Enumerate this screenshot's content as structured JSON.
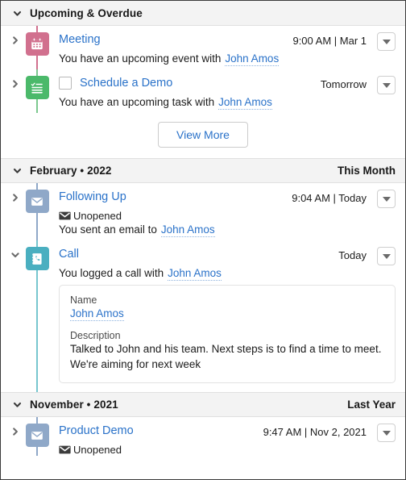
{
  "colors": {
    "link": "#2a72c9",
    "header_bg": "#f3f3f3",
    "event_badge": "#d1708e",
    "task_badge": "#4bb96a",
    "email_badge": "#8fa8c8",
    "call_badge": "#4aafc0"
  },
  "sections": [
    {
      "id": "upcoming",
      "title": "Upcoming & Overdue",
      "meta": "",
      "expanded": true
    },
    {
      "id": "february",
      "title": "February • 2022",
      "meta": "This Month",
      "expanded": true
    },
    {
      "id": "november",
      "title": "November • 2021",
      "meta": "Last Year",
      "expanded": true
    }
  ],
  "upcoming_items": [
    {
      "icon": "calendar-icon",
      "title": "Meeting",
      "time": "9:00 AM | Mar 1",
      "description": "You have an upcoming event with",
      "related_record": "John Amos",
      "has_checkbox": false,
      "badge_color": "#d1708e",
      "rail_color": "#d1708e"
    },
    {
      "icon": "task-list-icon",
      "title": "Schedule a Demo",
      "time": "Tomorrow",
      "description": "You have an upcoming task with",
      "related_record": "John Amos",
      "has_checkbox": true,
      "badge_color": "#4bb96a",
      "rail_color": "#7cc98f"
    }
  ],
  "view_more": {
    "label": "View More"
  },
  "february_items": [
    {
      "icon": "email-icon",
      "title": "Following Up",
      "time": "9:04 AM | Today",
      "status": "Unopened",
      "description": "You sent an email to",
      "related_record": "John Amos",
      "badge_color": "#8fa8c8",
      "rail_color": "#8fa8c8",
      "expanded": false
    },
    {
      "icon": "call-log-icon",
      "title": "Call",
      "time": "Today",
      "description": "You logged a call with",
      "related_record": "John Amos",
      "badge_color": "#4aafc0",
      "rail_color": "#77c6cf",
      "expanded": true,
      "details": {
        "name_label": "Name",
        "name_value": "John Amos",
        "description_label": "Description",
        "description_value": "Talked to John and his team. Next steps is to find a time to meet. We're aiming for next week"
      }
    }
  ],
  "november_items": [
    {
      "icon": "email-icon",
      "title": "Product Demo",
      "time": "9:47 AM | Nov 2, 2021",
      "status": "Unopened",
      "badge_color": "#8fa8c8",
      "rail_color": "#8fa8c8"
    }
  ]
}
